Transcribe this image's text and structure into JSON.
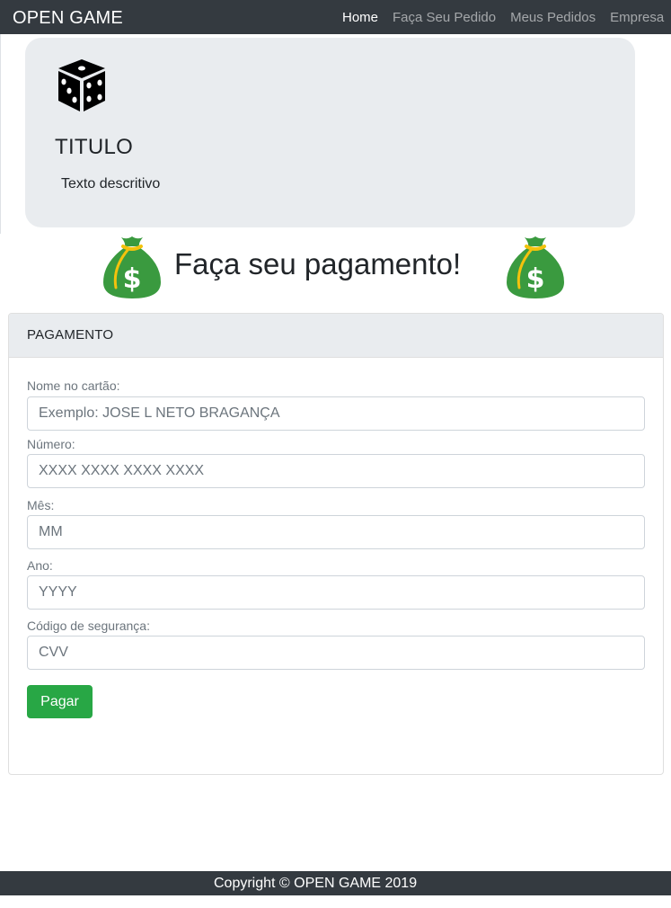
{
  "navbar": {
    "brand": "OPEN GAME",
    "links": [
      {
        "label": "Home",
        "active": true
      },
      {
        "label": "Faça Seu Pedido",
        "active": false
      },
      {
        "label": "Meus Pedidos",
        "active": false
      },
      {
        "label": "Empresa",
        "active": false
      }
    ]
  },
  "hero": {
    "icon": "dice-icon",
    "title": "TITULO",
    "text": "Texto descritivo"
  },
  "heading": {
    "text": "Faça seu pagamento!",
    "icon": "money-bag-icon"
  },
  "payment_card": {
    "header": "PAGAMENTO",
    "fields": [
      {
        "label": "Nome no cartão:",
        "placeholder": "Exemplo: JOSE L NETO BRAGANÇA",
        "value": ""
      },
      {
        "label": "Número:",
        "placeholder": "XXXX XXXX XXXX XXXX",
        "value": ""
      },
      {
        "label": "Mês:",
        "placeholder": "MM",
        "value": ""
      },
      {
        "label": "Ano:",
        "placeholder": "YYYY",
        "value": ""
      },
      {
        "label": "Código de segurança:",
        "placeholder": "CVV",
        "value": ""
      }
    ],
    "submit_label": "Pagar"
  },
  "footer": {
    "text": "Copyright © OPEN GAME 2019"
  },
  "colors": {
    "navbar_bg": "#343a40",
    "hero_bg": "#e9ecef",
    "button_green": "#28a745",
    "money_bag_green": "#3a9a3f",
    "money_bag_tie": "#f4c20d"
  }
}
